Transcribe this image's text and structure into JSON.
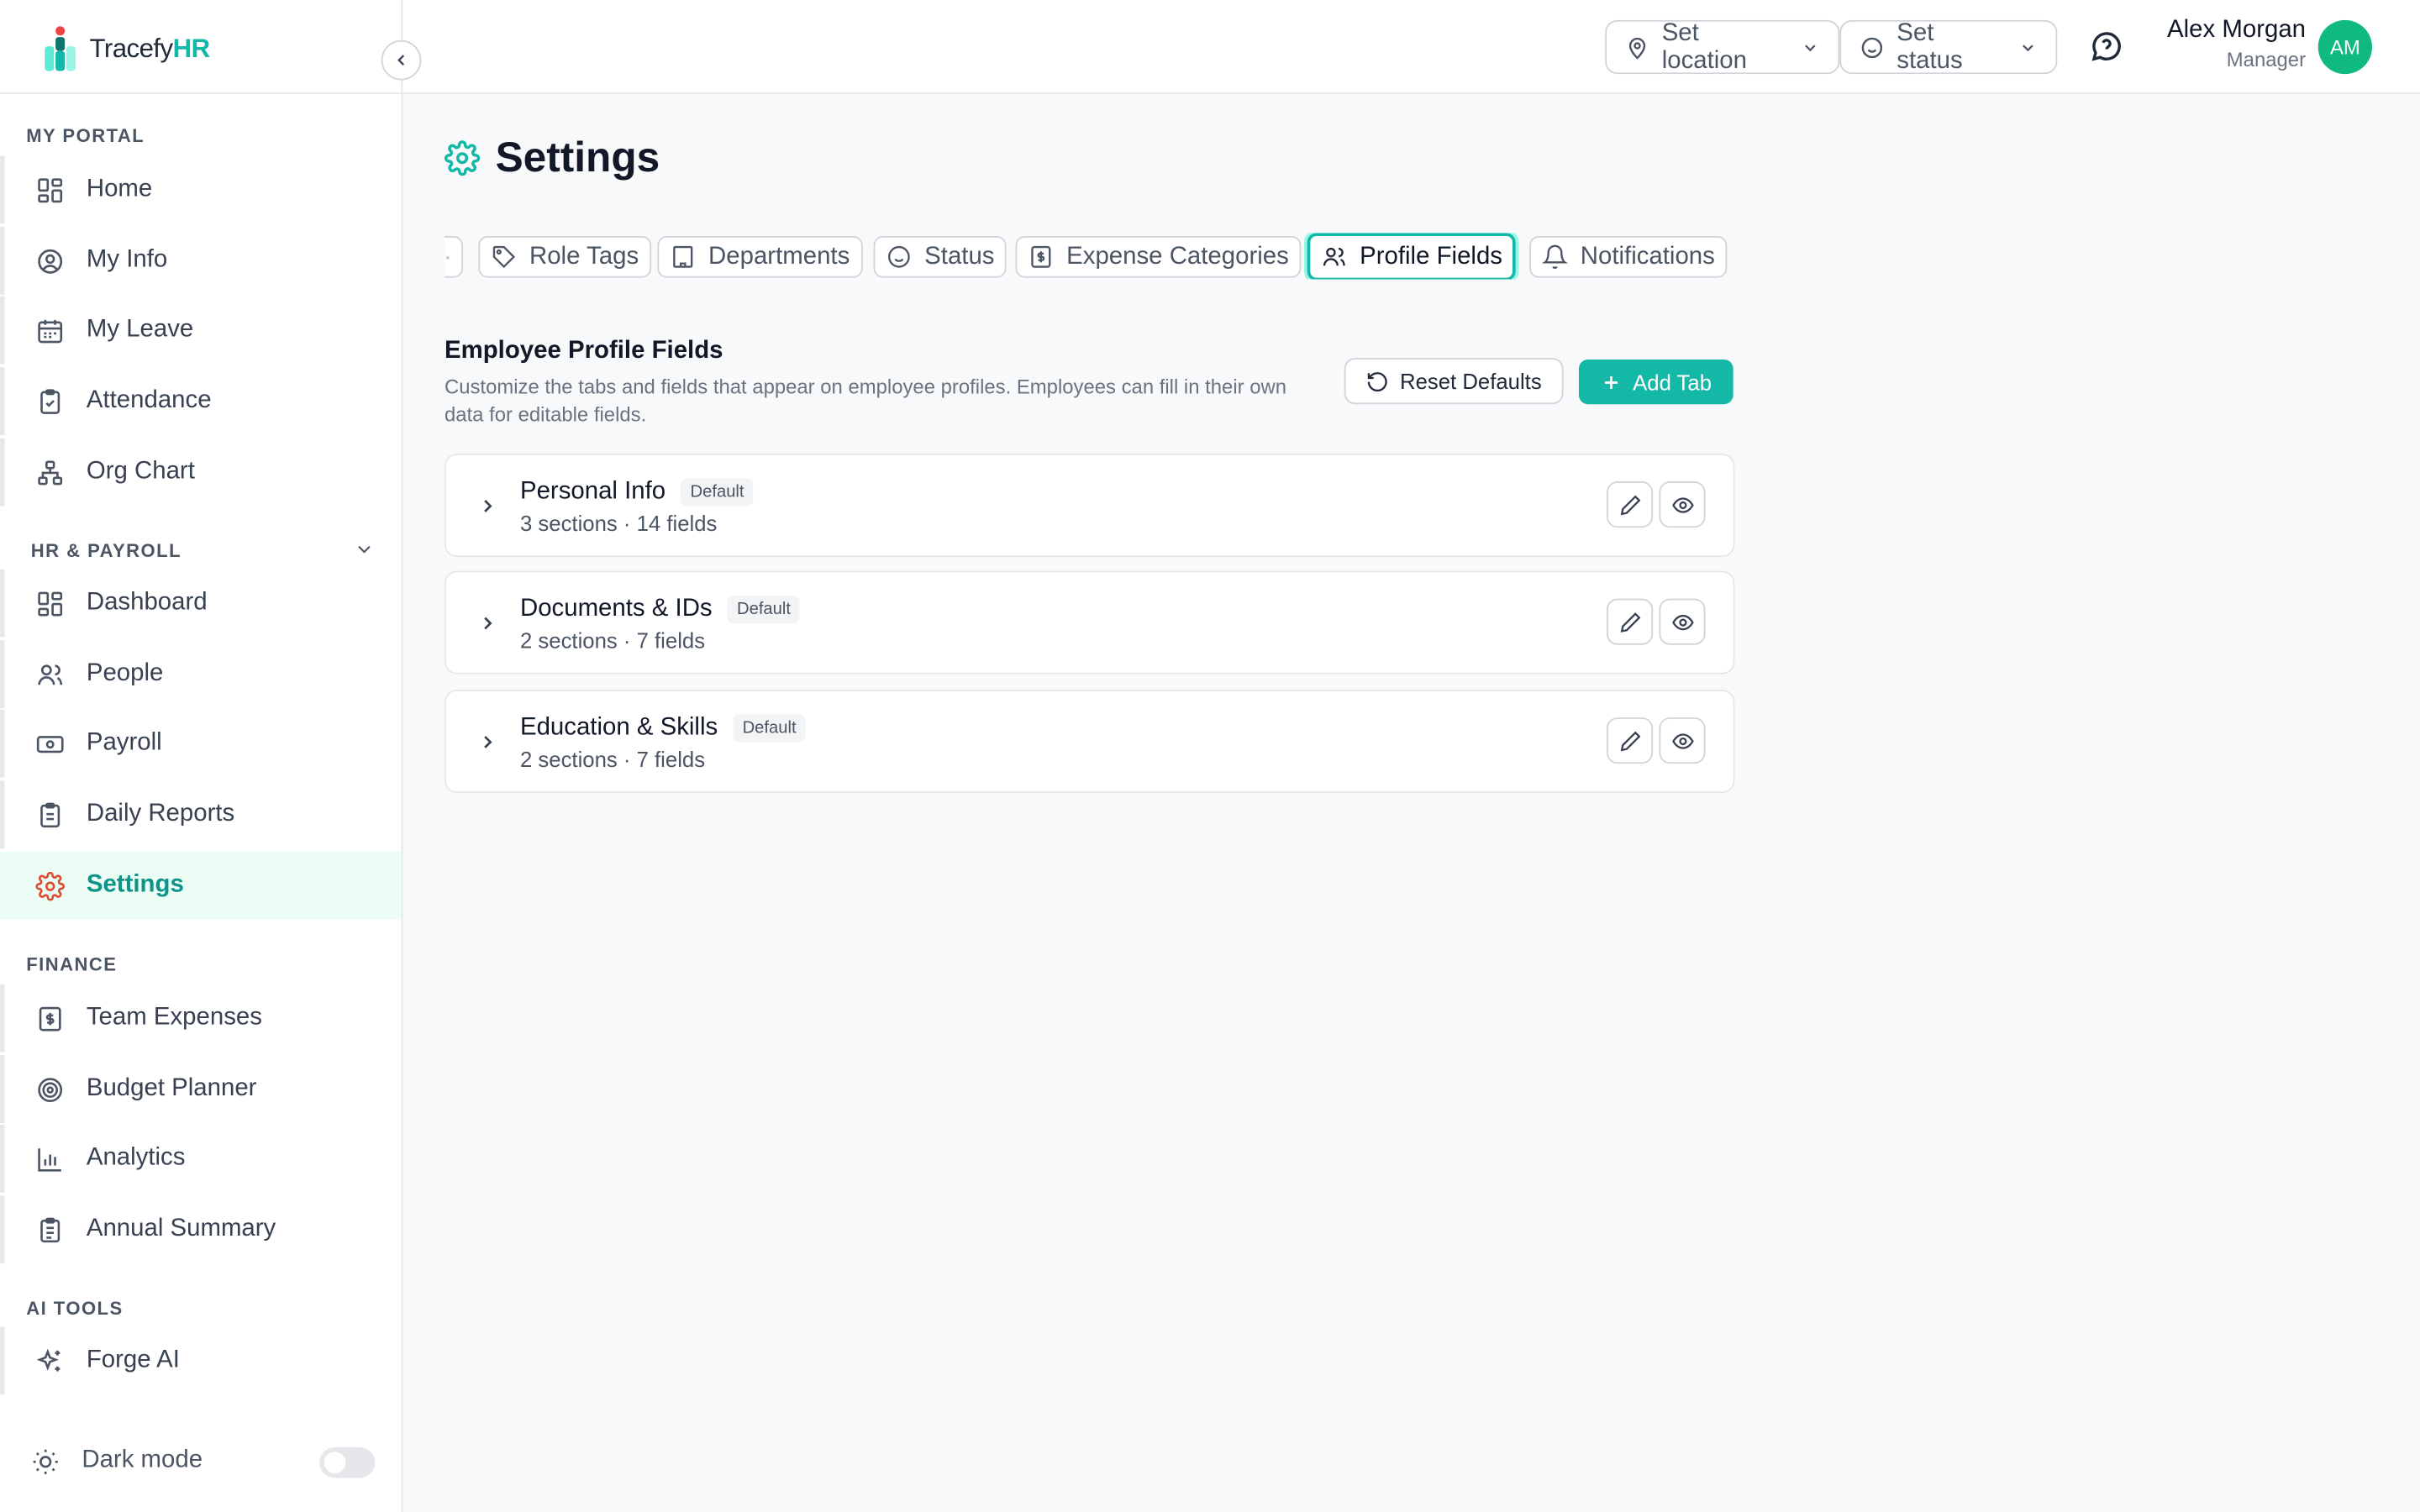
{
  "brand": {
    "name_part1": "Tracefy",
    "name_part2": "HR"
  },
  "topbar": {
    "location_label": "Set location",
    "status_label": "Set status",
    "user_name": "Alex Morgan",
    "user_role": "Manager",
    "avatar_initials": "AM"
  },
  "sidebar": {
    "sections": {
      "my_portal": "MY PORTAL",
      "hr_payroll": "HR & PAYROLL",
      "finance": "FINANCE",
      "ai_tools": "AI TOOLS"
    },
    "items": [
      {
        "label": "Home",
        "icon": "grid-icon"
      },
      {
        "label": "My Info",
        "icon": "user-circle-icon"
      },
      {
        "label": "My Leave",
        "icon": "calendar-icon"
      },
      {
        "label": "Attendance",
        "icon": "clipboard-check-icon"
      },
      {
        "label": "Org Chart",
        "icon": "org-chart-icon"
      },
      {
        "label": "Dashboard",
        "icon": "grid-icon"
      },
      {
        "label": "People",
        "icon": "users-icon"
      },
      {
        "label": "Payroll",
        "icon": "banknote-icon"
      },
      {
        "label": "Daily Reports",
        "icon": "clipboard-list-icon"
      },
      {
        "label": "Settings",
        "icon": "gear-icon",
        "active": true
      },
      {
        "label": "Team Expenses",
        "icon": "receipt-icon"
      },
      {
        "label": "Budget Planner",
        "icon": "target-icon"
      },
      {
        "label": "Analytics",
        "icon": "bar-chart-icon"
      },
      {
        "label": "Annual Summary",
        "icon": "clipboard-icon"
      },
      {
        "label": "Forge AI",
        "icon": "sparkles-icon"
      }
    ],
    "dark_mode_label": "Dark mode",
    "dark_mode_on": false
  },
  "page": {
    "title": "Settings",
    "tabs": [
      {
        "label": "Role Tags",
        "icon": "tag-icon"
      },
      {
        "label": "Departments",
        "icon": "building-icon"
      },
      {
        "label": "Status",
        "icon": "smile-icon"
      },
      {
        "label": "Expense Categories",
        "icon": "receipt-icon"
      },
      {
        "label": "Profile Fields",
        "icon": "users-icon",
        "active": true
      },
      {
        "label": "Notifications",
        "icon": "bell-icon"
      }
    ],
    "section_title": "Employee Profile Fields",
    "section_description": "Customize the tabs and fields that appear on employee profiles. Employees can fill in their own data for editable fields.",
    "reset_label": "Reset Defaults",
    "add_label": "Add Tab",
    "profile_tabs": [
      {
        "name": "Personal Info",
        "badge": "Default",
        "meta": "3 sections · 14 fields"
      },
      {
        "name": "Documents & IDs",
        "badge": "Default",
        "meta": "2 sections · 7 fields"
      },
      {
        "name": "Education & Skills",
        "badge": "Default",
        "meta": "2 sections · 7 fields"
      }
    ]
  },
  "colors": {
    "accent": "#14b8a6",
    "active_bg": "#ecfdf5",
    "settings_icon": "#dc4b2f",
    "avatar": "#10b981"
  }
}
